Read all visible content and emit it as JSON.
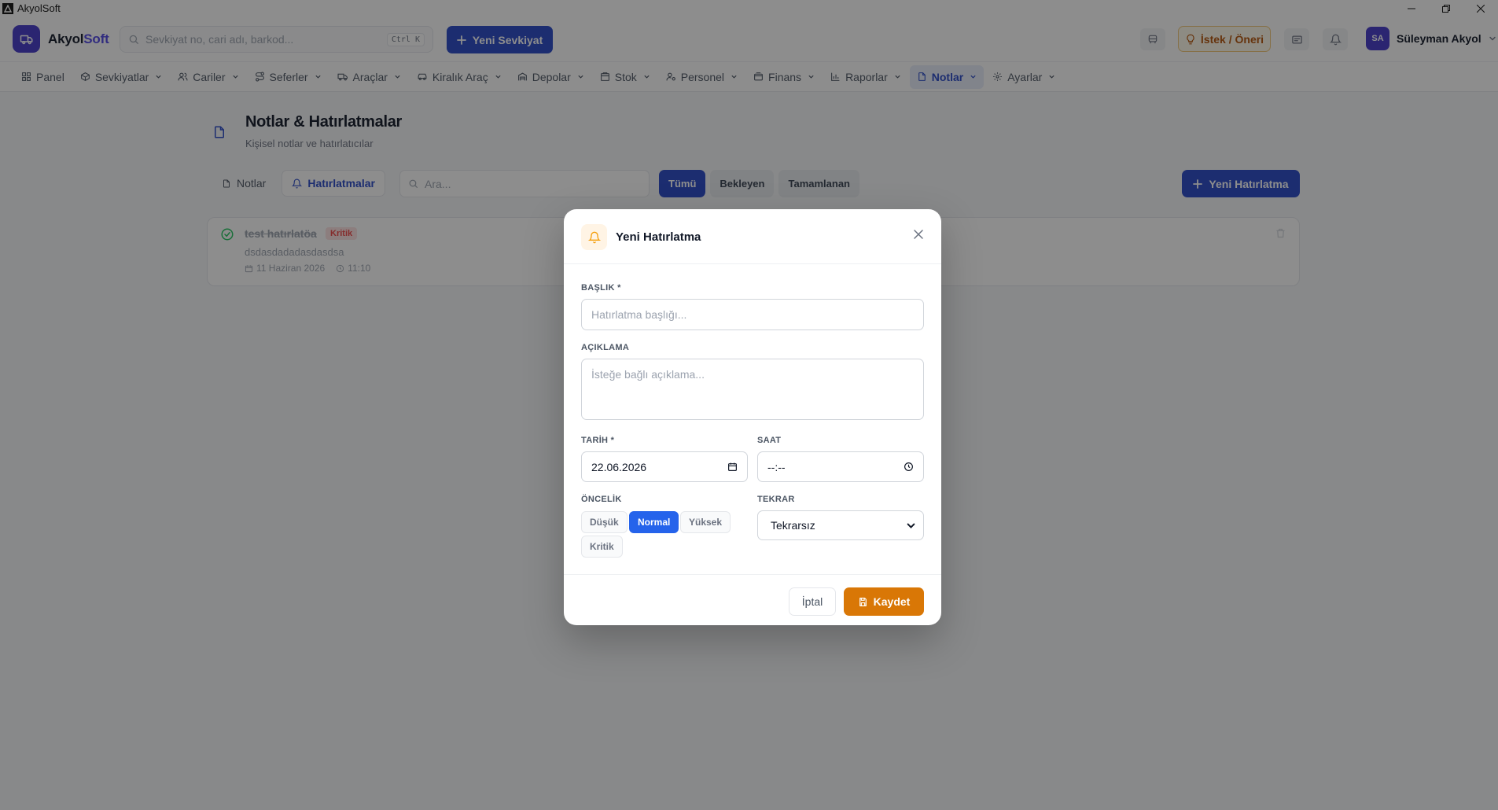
{
  "window": {
    "title": "AkyolSoft"
  },
  "header": {
    "brand_main": "Akyol",
    "brand_accent": "Soft",
    "search_placeholder": "Sevkiyat no, cari adı, barkod...",
    "search_shortcut": "Ctrl K",
    "new_shipment": "Yeni Sevkiyat",
    "suggestion": "İstek / Öneri",
    "user_initials": "SA",
    "user_name": "Süleyman Akyol"
  },
  "nav": {
    "items": [
      {
        "label": "Panel",
        "icon": "grid-icon"
      },
      {
        "label": "Sevkiyatlar",
        "icon": "box-icon"
      },
      {
        "label": "Cariler",
        "icon": "users-icon"
      },
      {
        "label": "Seferler",
        "icon": "route-icon"
      },
      {
        "label": "Araçlar",
        "icon": "truck-icon"
      },
      {
        "label": "Kiralık Araç",
        "icon": "car-icon"
      },
      {
        "label": "Depolar",
        "icon": "warehouse-icon"
      },
      {
        "label": "Stok",
        "icon": "package-icon"
      },
      {
        "label": "Personel",
        "icon": "user-gear-icon"
      },
      {
        "label": "Finans",
        "icon": "wallet-icon"
      },
      {
        "label": "Raporlar",
        "icon": "bar-chart-icon"
      },
      {
        "label": "Notlar",
        "icon": "file-icon"
      },
      {
        "label": "Ayarlar",
        "icon": "gear-icon"
      }
    ],
    "active": "Notlar"
  },
  "page": {
    "title": "Notlar & Hatırlatmalar",
    "subtitle": "Kişisel notlar ve hatırlatıcılar",
    "tabs": [
      "Notlar",
      "Hatırlatmalar"
    ],
    "active_tab": "Hatırlatmalar",
    "search_placeholder": "Ara...",
    "filters": [
      "Tümü",
      "Bekleyen",
      "Tamamlanan"
    ],
    "active_filter": "Tümü",
    "new_reminder": "Yeni Hatırlatma"
  },
  "reminders": [
    {
      "title": "test hatırlatöa",
      "priority": "Kritik",
      "description": "dsdasdadadasdasdsa",
      "date": "11 Haziran 2026",
      "time": "11:10",
      "completed": true
    }
  ],
  "modal": {
    "title": "Yeni Hatırlatma",
    "title_label": "BAŞLIK *",
    "title_placeholder": "Hatırlatma başlığı...",
    "desc_label": "AÇIKLAMA",
    "desc_placeholder": "İsteğe bağlı açıklama...",
    "date_label": "TARİH *",
    "date_value": "22.06.2026",
    "time_label": "SAAT",
    "time_value": "--:--",
    "priority_label": "ÖNCELİK",
    "priorities": [
      "Düşük",
      "Normal",
      "Yüksek",
      "Kritik"
    ],
    "selected_priority": "Normal",
    "repeat_label": "TEKRAR",
    "repeat_value": "Tekrarsız",
    "cancel": "İptal",
    "save": "Kaydet"
  },
  "colors": {
    "primary": "#2748c7",
    "brand": "#4338ca",
    "save": "#d97706",
    "danger": "#ef4444",
    "success": "#22c55e"
  }
}
